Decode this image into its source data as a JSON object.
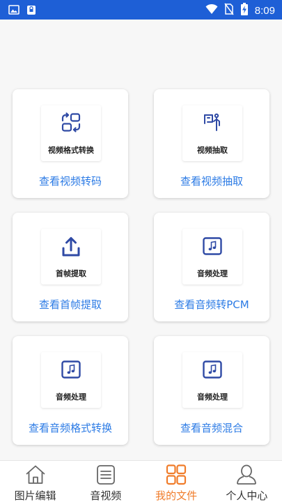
{
  "status_bar": {
    "time": "8:09"
  },
  "cards": [
    {
      "icon": "convert-icon",
      "label": "视频格式转换",
      "link": "查看视频转码"
    },
    {
      "icon": "extract-icon",
      "label": "视频抽取",
      "link": "查看视频抽取"
    },
    {
      "icon": "upload-icon",
      "label": "首帧提取",
      "link": "查看首帧提取"
    },
    {
      "icon": "music-note-icon",
      "label": "音频处理",
      "link": "查看音频转PCM"
    },
    {
      "icon": "music-note-icon",
      "label": "音频处理",
      "link": "查看音频格式转换"
    },
    {
      "icon": "music-note-icon",
      "label": "音频处理",
      "link": "查看音频混合"
    }
  ],
  "bottom_nav": [
    {
      "icon": "home-icon",
      "label": "图片编辑",
      "active": false
    },
    {
      "icon": "list-icon",
      "label": "音视频",
      "active": false
    },
    {
      "icon": "grid-icon",
      "label": "我的文件",
      "active": true
    },
    {
      "icon": "person-icon",
      "label": "个人中心",
      "active": false
    }
  ],
  "colors": {
    "status_bar": "#1e5fd6",
    "icon": "#2f4aa5",
    "link": "#2c7be5",
    "nav_active": "#f07c2a",
    "nav_inactive": "#666666"
  }
}
